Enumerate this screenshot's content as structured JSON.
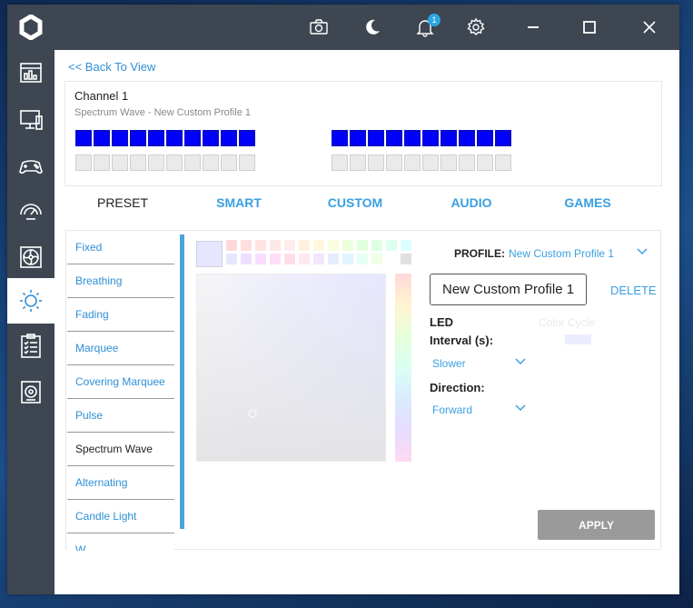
{
  "titlebar": {
    "notification_count": "1",
    "icons": [
      "camera-icon",
      "moon-icon",
      "bell-icon",
      "gear-icon",
      "minimize-icon",
      "maximize-icon",
      "close-icon"
    ]
  },
  "sidebar": {
    "items": [
      "app-logo-icon",
      "dashboard-icon",
      "monitor-icon",
      "gamepad-icon",
      "gauge-icon",
      "fan-icon",
      "lighting-icon",
      "checklist-icon",
      "speaker-icon"
    ],
    "active": "lighting-icon"
  },
  "main": {
    "back_link": "<< Back To View",
    "channel": {
      "title": "Channel 1",
      "subtitle": "Spectrum Wave - New Custom Profile 1",
      "led_color": "#0000ff",
      "leds_per_group": 10
    },
    "tabs": [
      {
        "label": "PRESET",
        "active": true
      },
      {
        "label": "SMART",
        "active": false
      },
      {
        "label": "CUSTOM",
        "active": false
      },
      {
        "label": "AUDIO",
        "active": false
      },
      {
        "label": "GAMES",
        "active": false
      }
    ],
    "effects": [
      {
        "label": "Fixed"
      },
      {
        "label": "Breathing"
      },
      {
        "label": "Fading"
      },
      {
        "label": "Marquee"
      },
      {
        "label": "Covering Marquee"
      },
      {
        "label": "Pulse"
      },
      {
        "label": "Spectrum Wave",
        "selected": true
      },
      {
        "label": "Alternating"
      },
      {
        "label": "Candle Light"
      },
      {
        "label": "W"
      }
    ],
    "color_panel": {
      "current_color": "#e6e6ff",
      "swatches": [
        "#ffd9d9",
        "#ffdede",
        "#ffe3e3",
        "#ffe8e8",
        "#ffeded",
        "#fff2dd",
        "#fff8dd",
        "#f7ffdd",
        "#ecffdd",
        "#e2ffdd",
        "#ddffe2",
        "#ddfff0",
        "#ddffff",
        "#e6e6ff",
        "#efdfff",
        "#f7ddff",
        "#ffddf7",
        "#ffddea",
        "#ffe8f0",
        "#f2e6ff",
        "#e6ecff",
        "#e0f5ff",
        "#e6fff7",
        "#f0ffe6",
        "#ffffff",
        "#e0e0e0"
      ]
    },
    "settings": {
      "profile_label": "PROFILE:",
      "profile_value": "New Custom Profile 1",
      "profile_name_input": "New Custom Profile 1",
      "delete_label": "DELETE",
      "led_label": "LED",
      "interval_label": "Interval (s):",
      "interval_value": "Slower",
      "direction_label": "Direction:",
      "direction_value": "Forward",
      "color_cycle_label": "Color Cycle",
      "apply_label": "APPLY"
    }
  }
}
